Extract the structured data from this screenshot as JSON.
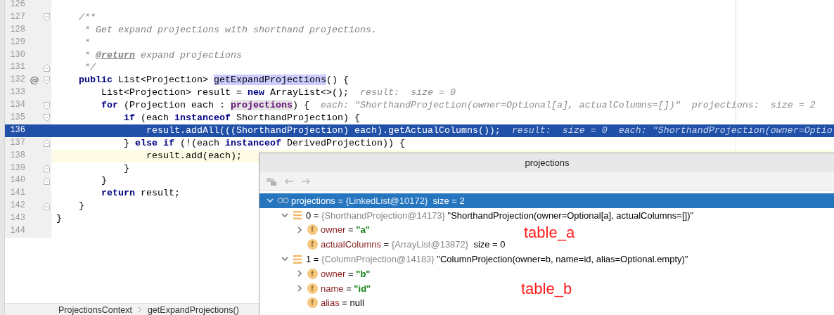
{
  "editor": {
    "lines": [
      {
        "number": "126",
        "caret": false,
        "executing": false
      },
      {
        "number": "127",
        "caret": false,
        "executing": false,
        "fold": {
          "kind": "start"
        },
        "code": [
          {
            "text": "    /**",
            "kind": "comment"
          }
        ]
      },
      {
        "number": "128",
        "caret": false,
        "executing": false,
        "code": [
          {
            "text": "     * Get expand projections with shorthand projections.",
            "kind": "comment"
          }
        ]
      },
      {
        "number": "129",
        "caret": false,
        "executing": false,
        "code": [
          {
            "text": "     *",
            "kind": "comment"
          }
        ]
      },
      {
        "number": "130",
        "caret": false,
        "executing": false,
        "code": [
          {
            "text": "     * ",
            "kind": "comment"
          },
          {
            "text": "@return",
            "kind": "doctag"
          },
          {
            "text": " expand projections",
            "kind": "comment"
          }
        ]
      },
      {
        "number": "131",
        "caret": false,
        "executing": false,
        "fold": {
          "kind": "end"
        },
        "code": [
          {
            "text": "     */",
            "kind": "comment"
          }
        ]
      },
      {
        "number": "132",
        "caret": false,
        "executing": false,
        "fold": {
          "kind": "start"
        },
        "marker": "@",
        "code": [
          {
            "text": "    public",
            "kind": "keyword"
          },
          {
            "text": " List<Projection> ",
            "kind": "plain"
          },
          {
            "text": "getExpandProjections",
            "kind": "usage"
          },
          {
            "text": "() {",
            "kind": "plain"
          }
        ]
      },
      {
        "number": "133",
        "caret": false,
        "executing": false,
        "code": [
          {
            "text": "        List<Projection> result = ",
            "kind": "plain"
          },
          {
            "text": "new",
            "kind": "keyword"
          },
          {
            "text": " ArrayList<>();",
            "kind": "plain"
          }
        ],
        "hint": "result:  size = 0"
      },
      {
        "number": "134",
        "caret": false,
        "executing": false,
        "fold": {
          "kind": "start"
        },
        "code": [
          {
            "text": "        for",
            "kind": "keyword"
          },
          {
            "text": " (Projection each : ",
            "kind": "plain"
          },
          {
            "text": "projections",
            "kind": "field"
          },
          {
            "text": ") {",
            "kind": "plain"
          }
        ],
        "hint": "each: \"ShorthandProjection(owner=Optional[a], actualColumns=[])\"  projections:  size = 2"
      },
      {
        "number": "135",
        "caret": false,
        "executing": false,
        "fold": {
          "kind": "start"
        },
        "code": [
          {
            "text": "            if",
            "kind": "keyword"
          },
          {
            "text": " (each ",
            "kind": "plain"
          },
          {
            "text": "instanceof",
            "kind": "keyword"
          },
          {
            "text": " ShorthandProjection) {",
            "kind": "plain"
          }
        ]
      },
      {
        "number": "136",
        "caret": false,
        "executing": true,
        "code": [
          {
            "text": "                result.addAll(((ShorthandProjection) each).getActualColumns());",
            "kind": "plain"
          }
        ],
        "hint": "result:  size = 0  each: \"ShorthandProjection(owner=Optio"
      },
      {
        "number": "137",
        "caret": false,
        "executing": false,
        "fold": {
          "kind": "end"
        },
        "code": [
          {
            "text": "            } ",
            "kind": "plain"
          },
          {
            "text": "else if",
            "kind": "keyword"
          },
          {
            "text": " (!(each ",
            "kind": "plain"
          },
          {
            "text": "instanceof",
            "kind": "keyword"
          },
          {
            "text": " DerivedProjection)) {",
            "kind": "plain"
          }
        ]
      },
      {
        "number": "138",
        "caret": true,
        "executing": false,
        "code": [
          {
            "text": "                result.add(each);",
            "kind": "plain"
          }
        ]
      },
      {
        "number": "139",
        "caret": false,
        "executing": false,
        "fold": {
          "kind": "end"
        },
        "code": [
          {
            "text": "            }",
            "kind": "plain"
          }
        ]
      },
      {
        "number": "140",
        "caret": false,
        "executing": false,
        "fold": {
          "kind": "end"
        },
        "code": [
          {
            "text": "        }",
            "kind": "plain"
          }
        ]
      },
      {
        "number": "141",
        "caret": false,
        "executing": false,
        "code": [
          {
            "text": "        return",
            "kind": "keyword"
          },
          {
            "text": " result;",
            "kind": "plain"
          }
        ]
      },
      {
        "number": "142",
        "caret": false,
        "executing": false,
        "fold": {
          "kind": "end"
        },
        "code": [
          {
            "text": "    }",
            "kind": "plain"
          }
        ]
      },
      {
        "number": "143",
        "caret": false,
        "executing": false,
        "code": [
          {
            "text": "}",
            "kind": "plain"
          }
        ]
      },
      {
        "number": "144",
        "caret": false,
        "executing": false
      }
    ]
  },
  "breadcrumbs": [
    "ProjectionsContext",
    "getExpandProjections()"
  ],
  "popup": {
    "title": "projections",
    "tree": [
      {
        "kind": "watch",
        "arrow": {
          "kind": "expanded"
        },
        "selected": true,
        "label": [
          {
            "text": "projections",
            "kind": "plain"
          },
          {
            "text": " = ",
            "kind": "plain"
          },
          {
            "text": "{LinkedList@10172}",
            "kind": "ref"
          },
          {
            "text": "  size = 2",
            "kind": "plain"
          }
        ],
        "children": [
          {
            "kind": "element",
            "arrow": {
              "kind": "expanded"
            },
            "selected": false,
            "label": [
              {
                "text": "0",
                "kind": "plain"
              },
              {
                "text": " = ",
                "kind": "plain"
              },
              {
                "text": "{ShorthandProjection@14173}",
                "kind": "ref"
              },
              {
                "text": " \"ShorthandProjection(owner=Optional[a], actualColumns=[])\"",
                "kind": "plain"
              }
            ],
            "children": [
              {
                "kind": "field",
                "badge": "f",
                "arrow": {
                  "kind": "collapsed"
                },
                "selected": false,
                "label": [
                  {
                    "text": "owner",
                    "kind": "name"
                  },
                  {
                    "text": " = ",
                    "kind": "plain"
                  },
                  {
                    "text": "\"a\"",
                    "kind": "string"
                  }
                ]
              },
              {
                "kind": "field",
                "badge": "f",
                "selected": false,
                "label": [
                  {
                    "text": "actualColumns",
                    "kind": "name"
                  },
                  {
                    "text": " = ",
                    "kind": "plain"
                  },
                  {
                    "text": "{ArrayList@13872}",
                    "kind": "ref"
                  },
                  {
                    "text": "  size = 0",
                    "kind": "plain"
                  }
                ]
              }
            ]
          },
          {
            "kind": "element",
            "arrow": {
              "kind": "expanded"
            },
            "selected": false,
            "label": [
              {
                "text": "1",
                "kind": "plain"
              },
              {
                "text": " = ",
                "kind": "plain"
              },
              {
                "text": "{ColumnProjection@14183}",
                "kind": "ref"
              },
              {
                "text": " \"ColumnProjection(owner=b, name=id, alias=Optional.empty)\"",
                "kind": "plain"
              }
            ],
            "children": [
              {
                "kind": "field",
                "badge": "f",
                "arrow": {
                  "kind": "collapsed"
                },
                "selected": false,
                "label": [
                  {
                    "text": "owner",
                    "kind": "name"
                  },
                  {
                    "text": " = ",
                    "kind": "plain"
                  },
                  {
                    "text": "\"b\"",
                    "kind": "string"
                  }
                ]
              },
              {
                "kind": "field",
                "badge": "f",
                "arrow": {
                  "kind": "collapsed"
                },
                "selected": false,
                "label": [
                  {
                    "text": "name",
                    "kind": "name"
                  },
                  {
                    "text": " = ",
                    "kind": "plain"
                  },
                  {
                    "text": "\"id\"",
                    "kind": "string"
                  }
                ]
              },
              {
                "kind": "field",
                "badge": "f",
                "selected": false,
                "label": [
                  {
                    "text": "alias",
                    "kind": "name"
                  },
                  {
                    "text": " = null",
                    "kind": "plain"
                  }
                ]
              }
            ]
          }
        ]
      }
    ]
  },
  "annotations": [
    "table_a",
    "table_b"
  ]
}
